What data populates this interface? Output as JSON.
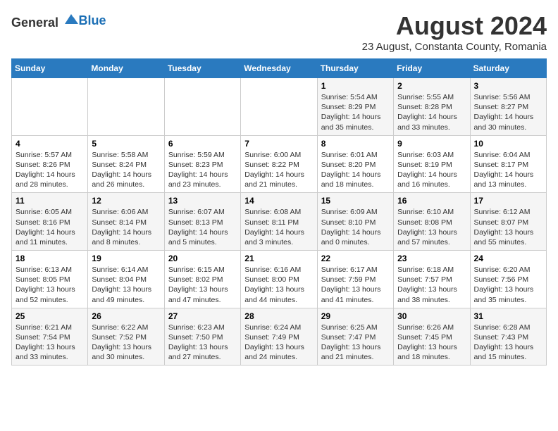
{
  "logo": {
    "text_general": "General",
    "text_blue": "Blue"
  },
  "title": "August 2024",
  "subtitle": "23 August, Constanta County, Romania",
  "days_of_week": [
    "Sunday",
    "Monday",
    "Tuesday",
    "Wednesday",
    "Thursday",
    "Friday",
    "Saturday"
  ],
  "weeks": [
    [
      {
        "day": "",
        "info": ""
      },
      {
        "day": "",
        "info": ""
      },
      {
        "day": "",
        "info": ""
      },
      {
        "day": "",
        "info": ""
      },
      {
        "day": "1",
        "info": "Sunrise: 5:54 AM\nSunset: 8:29 PM\nDaylight: 14 hours and 35 minutes."
      },
      {
        "day": "2",
        "info": "Sunrise: 5:55 AM\nSunset: 8:28 PM\nDaylight: 14 hours and 33 minutes."
      },
      {
        "day": "3",
        "info": "Sunrise: 5:56 AM\nSunset: 8:27 PM\nDaylight: 14 hours and 30 minutes."
      }
    ],
    [
      {
        "day": "4",
        "info": "Sunrise: 5:57 AM\nSunset: 8:26 PM\nDaylight: 14 hours and 28 minutes."
      },
      {
        "day": "5",
        "info": "Sunrise: 5:58 AM\nSunset: 8:24 PM\nDaylight: 14 hours and 26 minutes."
      },
      {
        "day": "6",
        "info": "Sunrise: 5:59 AM\nSunset: 8:23 PM\nDaylight: 14 hours and 23 minutes."
      },
      {
        "day": "7",
        "info": "Sunrise: 6:00 AM\nSunset: 8:22 PM\nDaylight: 14 hours and 21 minutes."
      },
      {
        "day": "8",
        "info": "Sunrise: 6:01 AM\nSunset: 8:20 PM\nDaylight: 14 hours and 18 minutes."
      },
      {
        "day": "9",
        "info": "Sunrise: 6:03 AM\nSunset: 8:19 PM\nDaylight: 14 hours and 16 minutes."
      },
      {
        "day": "10",
        "info": "Sunrise: 6:04 AM\nSunset: 8:17 PM\nDaylight: 14 hours and 13 minutes."
      }
    ],
    [
      {
        "day": "11",
        "info": "Sunrise: 6:05 AM\nSunset: 8:16 PM\nDaylight: 14 hours and 11 minutes."
      },
      {
        "day": "12",
        "info": "Sunrise: 6:06 AM\nSunset: 8:14 PM\nDaylight: 14 hours and 8 minutes."
      },
      {
        "day": "13",
        "info": "Sunrise: 6:07 AM\nSunset: 8:13 PM\nDaylight: 14 hours and 5 minutes."
      },
      {
        "day": "14",
        "info": "Sunrise: 6:08 AM\nSunset: 8:11 PM\nDaylight: 14 hours and 3 minutes."
      },
      {
        "day": "15",
        "info": "Sunrise: 6:09 AM\nSunset: 8:10 PM\nDaylight: 14 hours and 0 minutes."
      },
      {
        "day": "16",
        "info": "Sunrise: 6:10 AM\nSunset: 8:08 PM\nDaylight: 13 hours and 57 minutes."
      },
      {
        "day": "17",
        "info": "Sunrise: 6:12 AM\nSunset: 8:07 PM\nDaylight: 13 hours and 55 minutes."
      }
    ],
    [
      {
        "day": "18",
        "info": "Sunrise: 6:13 AM\nSunset: 8:05 PM\nDaylight: 13 hours and 52 minutes."
      },
      {
        "day": "19",
        "info": "Sunrise: 6:14 AM\nSunset: 8:04 PM\nDaylight: 13 hours and 49 minutes."
      },
      {
        "day": "20",
        "info": "Sunrise: 6:15 AM\nSunset: 8:02 PM\nDaylight: 13 hours and 47 minutes."
      },
      {
        "day": "21",
        "info": "Sunrise: 6:16 AM\nSunset: 8:00 PM\nDaylight: 13 hours and 44 minutes."
      },
      {
        "day": "22",
        "info": "Sunrise: 6:17 AM\nSunset: 7:59 PM\nDaylight: 13 hours and 41 minutes."
      },
      {
        "day": "23",
        "info": "Sunrise: 6:18 AM\nSunset: 7:57 PM\nDaylight: 13 hours and 38 minutes."
      },
      {
        "day": "24",
        "info": "Sunrise: 6:20 AM\nSunset: 7:56 PM\nDaylight: 13 hours and 35 minutes."
      }
    ],
    [
      {
        "day": "25",
        "info": "Sunrise: 6:21 AM\nSunset: 7:54 PM\nDaylight: 13 hours and 33 minutes."
      },
      {
        "day": "26",
        "info": "Sunrise: 6:22 AM\nSunset: 7:52 PM\nDaylight: 13 hours and 30 minutes."
      },
      {
        "day": "27",
        "info": "Sunrise: 6:23 AM\nSunset: 7:50 PM\nDaylight: 13 hours and 27 minutes."
      },
      {
        "day": "28",
        "info": "Sunrise: 6:24 AM\nSunset: 7:49 PM\nDaylight: 13 hours and 24 minutes."
      },
      {
        "day": "29",
        "info": "Sunrise: 6:25 AM\nSunset: 7:47 PM\nDaylight: 13 hours and 21 minutes."
      },
      {
        "day": "30",
        "info": "Sunrise: 6:26 AM\nSunset: 7:45 PM\nDaylight: 13 hours and 18 minutes."
      },
      {
        "day": "31",
        "info": "Sunrise: 6:28 AM\nSunset: 7:43 PM\nDaylight: 13 hours and 15 minutes."
      }
    ]
  ]
}
